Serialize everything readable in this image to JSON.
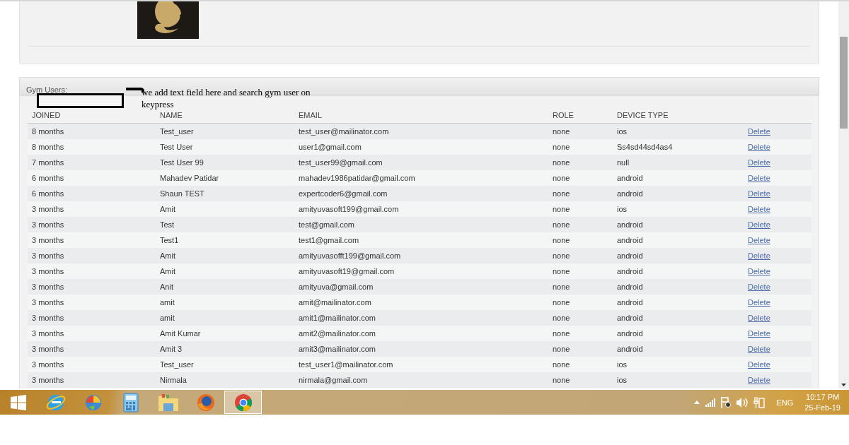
{
  "gym_users": {
    "title": "Gym Users:",
    "annotation": "we add text field here and search gym user on keypress",
    "columns": [
      "JOINED",
      "NAME",
      "EMAIL",
      "ROLE",
      "DEVICE TYPE"
    ],
    "rows": [
      {
        "joined": "8 months",
        "name": "Test_user",
        "email": "test_user@mailinator.com",
        "role": "none",
        "device_type": "ios",
        "action": "Delete"
      },
      {
        "joined": "8 months",
        "name": "Test User",
        "email": "user1@gmail.com",
        "role": "none",
        "device_type": "Ss4sd44sd4as4",
        "action": "Delete"
      },
      {
        "joined": "7 months",
        "name": "Test User 99",
        "email": "test_user99@gmail.com",
        "role": "none",
        "device_type": "null",
        "action": "Delete"
      },
      {
        "joined": "6 months",
        "name": "Mahadev Patidar",
        "email": "mahadev1986patidar@gmail.com",
        "role": "none",
        "device_type": "android",
        "action": "Delete"
      },
      {
        "joined": "6 months",
        "name": "Shaun TEST",
        "email": "expertcoder6@gmail.com",
        "role": "none",
        "device_type": "android",
        "action": "Delete"
      },
      {
        "joined": "3 months",
        "name": "Amit",
        "email": "amityuvasoft199@gmail.com",
        "role": "none",
        "device_type": "ios",
        "action": "Delete"
      },
      {
        "joined": "3 months",
        "name": "Test",
        "email": "test@gmail.com",
        "role": "none",
        "device_type": "android",
        "action": "Delete"
      },
      {
        "joined": "3 months",
        "name": "Test1",
        "email": "test1@gmail.com",
        "role": "none",
        "device_type": "android",
        "action": "Delete"
      },
      {
        "joined": "3 months",
        "name": "Amit",
        "email": "amityuvasofft199@gmail.com",
        "role": "none",
        "device_type": "android",
        "action": "Delete"
      },
      {
        "joined": "3 months",
        "name": "Amit",
        "email": "amityuvasoft19@gmail.com",
        "role": "none",
        "device_type": "android",
        "action": "Delete"
      },
      {
        "joined": "3 months",
        "name": "Anit",
        "email": "amityuva@gmail.com",
        "role": "none",
        "device_type": "android",
        "action": "Delete"
      },
      {
        "joined": "3 months",
        "name": "amit",
        "email": "amit@mailinator.com",
        "role": "none",
        "device_type": "android",
        "action": "Delete"
      },
      {
        "joined": "3 months",
        "name": "amit",
        "email": "amit1@mailinator.com",
        "role": "none",
        "device_type": "android",
        "action": "Delete"
      },
      {
        "joined": "3 months",
        "name": "Amit Kumar",
        "email": "amit2@mailinator.com",
        "role": "none",
        "device_type": "android",
        "action": "Delete"
      },
      {
        "joined": "3 months",
        "name": "Amit 3",
        "email": "amit3@mailinator.com",
        "role": "none",
        "device_type": "android",
        "action": "Delete"
      },
      {
        "joined": "3 months",
        "name": "Test_user",
        "email": "test_user1@mailinator.com",
        "role": "none",
        "device_type": "ios",
        "action": "Delete"
      },
      {
        "joined": "3 months",
        "name": "Nirmala",
        "email": "nirmala@gmail.com",
        "role": "none",
        "device_type": "ios",
        "action": "Delete"
      }
    ]
  },
  "taskbar": {
    "apps": [
      {
        "selected": false
      },
      {
        "selected": false
      },
      {
        "selected": false
      },
      {
        "selected": false
      },
      {
        "selected": false
      },
      {
        "selected": true
      }
    ],
    "language": "ENG",
    "time": "10:17 PM",
    "date": "25-Feb-19"
  }
}
